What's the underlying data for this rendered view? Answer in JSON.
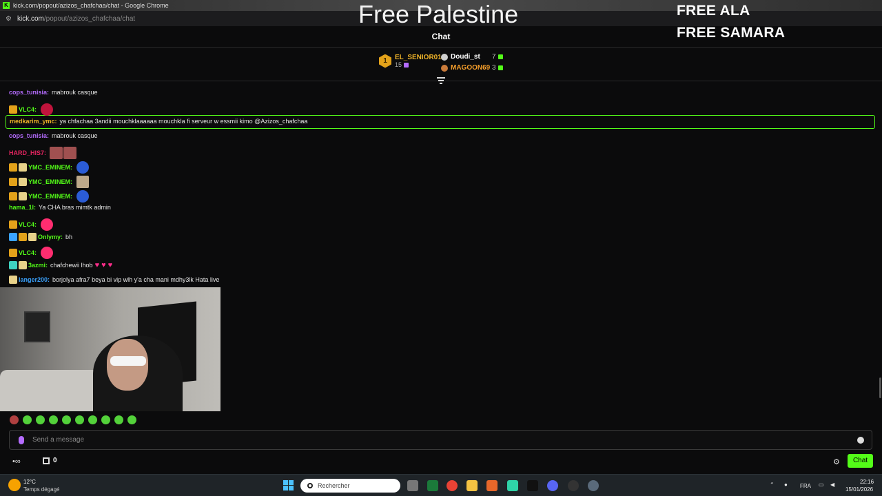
{
  "browser": {
    "tab_title": "kick.com/popout/azizos_chafchaa/chat - Google Chrome",
    "url_host": "kick.com",
    "url_path": "/popout/azizos_chafchaa/chat"
  },
  "overlay": {
    "title": "Free Palestine",
    "free_lines": [
      "FREE ALA",
      "FREE SAMARA"
    ]
  },
  "chat": {
    "header": "Chat",
    "leaderboard": {
      "first": {
        "rank": "1",
        "name": "EL_SENIOR01",
        "count": "15"
      },
      "others": [
        {
          "name": "Doudi_st",
          "count": "7",
          "color": "#ffffff"
        },
        {
          "name": "MAGOON69",
          "count": "3",
          "color": "#f59e2b"
        }
      ]
    },
    "messages": [
      {
        "user": "cops_tunisia",
        "color": "#b56cff",
        "badges": [],
        "text": "mabrouk casque",
        "emotes": []
      },
      {
        "user": "VLC4",
        "color": "#53fc18",
        "badges": [
          "crown"
        ],
        "text": "",
        "emotes": [
          "red-gem"
        ]
      },
      {
        "user": "medkarim_ymc",
        "color": "#f0b429",
        "badges": [],
        "text": "ya chfachaa 3andii mouchklaaaaaa mouchkla fi serveur w essmii kimo @Azizos_chafchaa",
        "emotes": [],
        "highlighted": true
      },
      {
        "user": "cops_tunisia",
        "color": "#b56cff",
        "badges": [],
        "text": "mabrouk casque",
        "emotes": []
      },
      {
        "user": "HARD_HIS7",
        "color": "#e0245e",
        "badges": [],
        "text": "",
        "emotes": [
          "face",
          "face"
        ]
      },
      {
        "user": "YMC_EMINEM",
        "color": "#53fc18",
        "badges": [
          "crown",
          "vip"
        ],
        "text": "",
        "emotes": [
          "blue-ball"
        ]
      },
      {
        "user": "YMC_EMINEM",
        "color": "#53fc18",
        "badges": [
          "crown",
          "vip"
        ],
        "text": "",
        "emotes": [
          "house"
        ]
      },
      {
        "user": "YMC_EMINEM",
        "color": "#53fc18",
        "badges": [
          "crown",
          "vip"
        ],
        "text": "",
        "emotes": [
          "blue-ball"
        ]
      },
      {
        "user": "hama_1l",
        "color": "#53fc18",
        "badges": [],
        "text": "Ya CHA bras mimtk admin",
        "emotes": []
      },
      {
        "user": "VLC4",
        "color": "#53fc18",
        "badges": [
          "crown"
        ],
        "text": "",
        "emotes": [
          "pink-circle"
        ]
      },
      {
        "user": "Onlymy",
        "color": "#53fc18",
        "badges": [
          "mod",
          "crown",
          "vip"
        ],
        "text": "bh",
        "emotes": []
      },
      {
        "user": "VLC4",
        "color": "#53fc18",
        "badges": [
          "crown"
        ],
        "text": "",
        "emotes": [
          "pink-circle"
        ]
      },
      {
        "user": "3azmi",
        "color": "#53fc18",
        "badges": [
          "grid",
          "vip"
        ],
        "text": "chafchewii lhob",
        "emotes": [
          "heart",
          "heart",
          "heart"
        ]
      },
      {
        "user": "langer200",
        "color": "#3ba3ff",
        "badges": [
          "vip"
        ],
        "text": "borjolya afra7 beya bi vip wlh y'a cha mani mdhy3lk Hata live",
        "emotes": []
      }
    ],
    "input_placeholder": "Send a message",
    "gift_count": "0",
    "chat_button": "Chat"
  },
  "taskbar": {
    "weather_temp": "12°C",
    "weather_desc": "Temps dégagé",
    "search_placeholder": "Rechercher",
    "language": "FRA",
    "time": "22:16",
    "date": "15/01/2026"
  },
  "colors": {
    "kick_green": "#53fc18",
    "accent_purple": "#b56cff"
  }
}
